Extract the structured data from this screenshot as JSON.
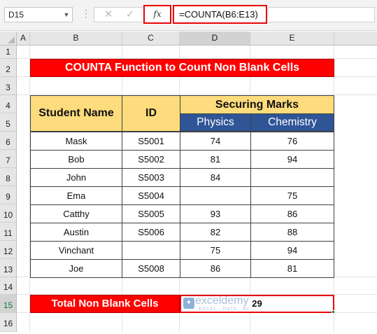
{
  "formula_bar": {
    "name_box": "D15",
    "fx_label": "fx",
    "formula": "=COUNTA(B6:E13)",
    "cancel_icon": "✕",
    "enter_icon": "✓"
  },
  "columns": [
    "A",
    "B",
    "C",
    "D",
    "E"
  ],
  "rows": [
    "1",
    "2",
    "3",
    "4",
    "5",
    "6",
    "7",
    "8",
    "9",
    "10",
    "11",
    "12",
    "13",
    "14",
    "15",
    "16"
  ],
  "selection": {
    "column": "D",
    "row": "15"
  },
  "sheet": {
    "title": "COUNTA Function to Count Non Blank Cells",
    "headers": {
      "student_name": "Student Name",
      "id": "ID",
      "securing_marks": "Securing Marks",
      "physics": "Physics",
      "chemistry": "Chemistry"
    },
    "rows": [
      {
        "name": "Mask",
        "id": "S5001",
        "physics": "74",
        "chemistry": "76"
      },
      {
        "name": "Bob",
        "id": "S5002",
        "physics": "81",
        "chemistry": "94"
      },
      {
        "name": "John",
        "id": "S5003",
        "physics": "84",
        "chemistry": ""
      },
      {
        "name": "Ema",
        "id": "S5004",
        "physics": "",
        "chemistry": "75"
      },
      {
        "name": "Catthy",
        "id": "S5005",
        "physics": "93",
        "chemistry": "86"
      },
      {
        "name": "Austin",
        "id": "S5006",
        "physics": "82",
        "chemistry": "88"
      },
      {
        "name": "Vinchant",
        "id": "",
        "physics": "75",
        "chemistry": "94"
      },
      {
        "name": "Joe",
        "id": "S5008",
        "physics": "86",
        "chemistry": "81"
      }
    ],
    "total_label": "Total Non Blank Cells",
    "total_value": "29"
  },
  "watermark": {
    "name": "exceldemy",
    "tagline": "EXCEL · DATA · BI"
  },
  "colors": {
    "title_red": "#ff0000",
    "header_yellow": "#fedc7d",
    "subheader_blue": "#2f5597",
    "highlight_border": "#e8050a",
    "excel_green": "#107c41"
  }
}
